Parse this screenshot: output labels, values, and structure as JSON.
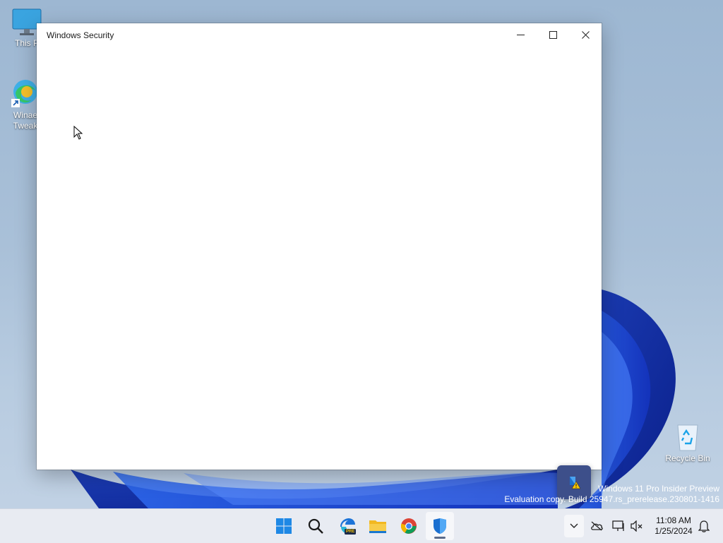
{
  "desktop": {
    "icons": [
      {
        "label_line1": "This P",
        "label_line2": "",
        "icon": "monitor-icon"
      },
      {
        "label_line1": "Winae",
        "label_line2": "Tweak",
        "icon": "edge-shortcut-icon"
      },
      {
        "label_line1": "Recycle Bin",
        "label_line2": "",
        "icon": "recycle-bin-icon"
      }
    ]
  },
  "window": {
    "title": "Windows Security",
    "controls": [
      "minimize-icon",
      "maximize-icon",
      "close-icon"
    ]
  },
  "notification": {
    "icon": "security-warning-icon"
  },
  "watermark": {
    "line1": "Windows 11 Pro Insider Preview",
    "line2": "Evaluation copy. Build 25947.rs_prerelease.230801-1416"
  },
  "taskbar": {
    "apps": [
      {
        "name": "start",
        "icon": "windows-start-icon"
      },
      {
        "name": "search",
        "icon": "search-icon"
      },
      {
        "name": "edge-preview",
        "icon": "edge-pre-icon",
        "badge": "PRE"
      },
      {
        "name": "file-explorer",
        "icon": "folder-icon"
      },
      {
        "name": "chrome",
        "icon": "chrome-icon"
      },
      {
        "name": "windows-security",
        "icon": "shield-icon",
        "active": true
      }
    ],
    "tray": {
      "icons": [
        "chevron-up-icon",
        "onedrive-offline-icon",
        "network-icon",
        "speaker-muted-icon",
        "notification-bell-icon"
      ],
      "time": "11:08 AM",
      "date": "1/25/2024"
    }
  },
  "colors": {
    "taskbar": "#e8ebf2",
    "window_bg": "#ffffff",
    "accent": "#0067c0"
  }
}
